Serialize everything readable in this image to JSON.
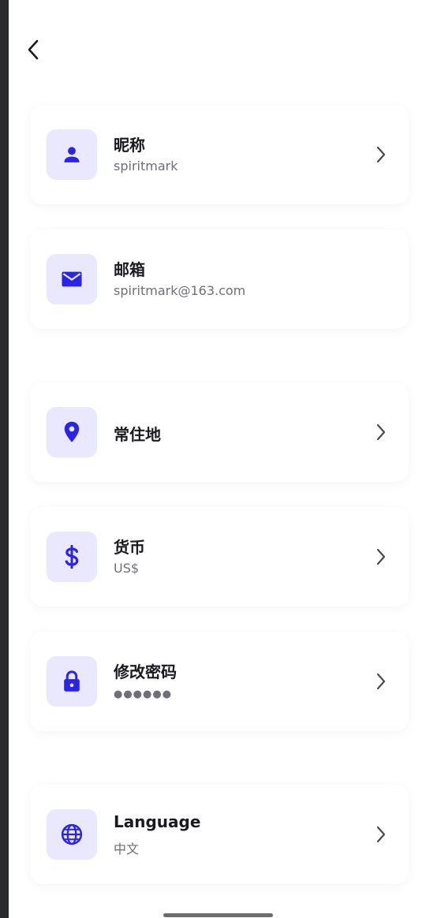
{
  "colors": {
    "accent": "#2a23e8",
    "icon_bg": "#e9e8ff",
    "title": "#1b1b1f",
    "subtitle": "#6f6f75"
  },
  "header": {
    "back_icon": "back-arrow-icon"
  },
  "settings": [
    {
      "id": "nickname",
      "icon": "user-icon",
      "title": "昵称",
      "subtitle": "spiritmark",
      "chevron": true
    },
    {
      "id": "email",
      "icon": "mail-icon",
      "title": "邮箱",
      "subtitle": "spiritmark@163.com",
      "chevron": false
    },
    {
      "id": "residence",
      "icon": "location-pin-icon",
      "title": "常住地",
      "subtitle": "",
      "chevron": true
    },
    {
      "id": "currency",
      "icon": "dollar-icon",
      "title": "货币",
      "subtitle": "US$",
      "chevron": true
    },
    {
      "id": "password",
      "icon": "lock-icon",
      "title": "修改密码",
      "subtitle": "●●●●●●",
      "chevron": true
    },
    {
      "id": "language",
      "icon": "globe-icon",
      "title": "Language",
      "subtitle": "中文",
      "chevron": true
    }
  ]
}
